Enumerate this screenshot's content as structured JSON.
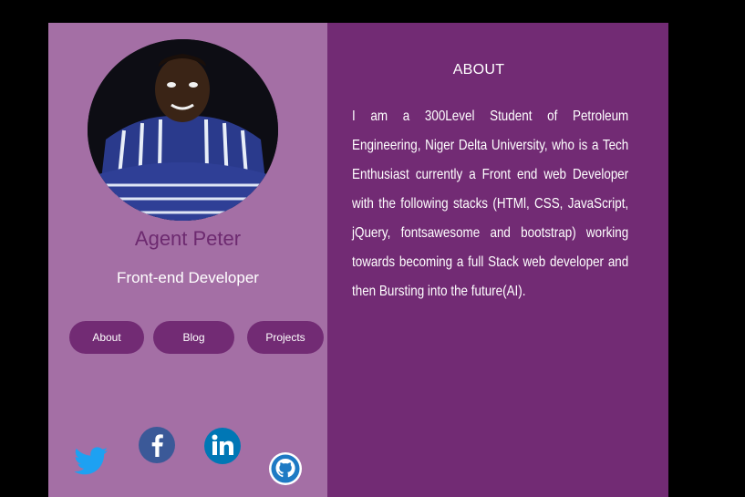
{
  "profile": {
    "name": "Agent Peter",
    "role": "Front-end Developer"
  },
  "nav": {
    "about": "About",
    "blog": "Blog",
    "projects": "Projects"
  },
  "about": {
    "title": "ABOUT",
    "text": "I am a 300Level Student of Petroleum Engineering, Niger Delta University, who is a Tech Enthusiast currently a Front end web Developer with the following stacks (HTMl, CSS, JavaScript, jQuery, fontsawesome and bootstrap) working towards becoming a full Stack web developer and then Bursting into the future(AI)."
  },
  "social": [
    "twitter-icon",
    "facebook-icon",
    "linkedin-icon",
    "github-icon"
  ],
  "colors": {
    "left_panel": "#a46fa5",
    "right_panel": "#722b74",
    "button": "#722b74",
    "name_text": "#6d2a70"
  }
}
